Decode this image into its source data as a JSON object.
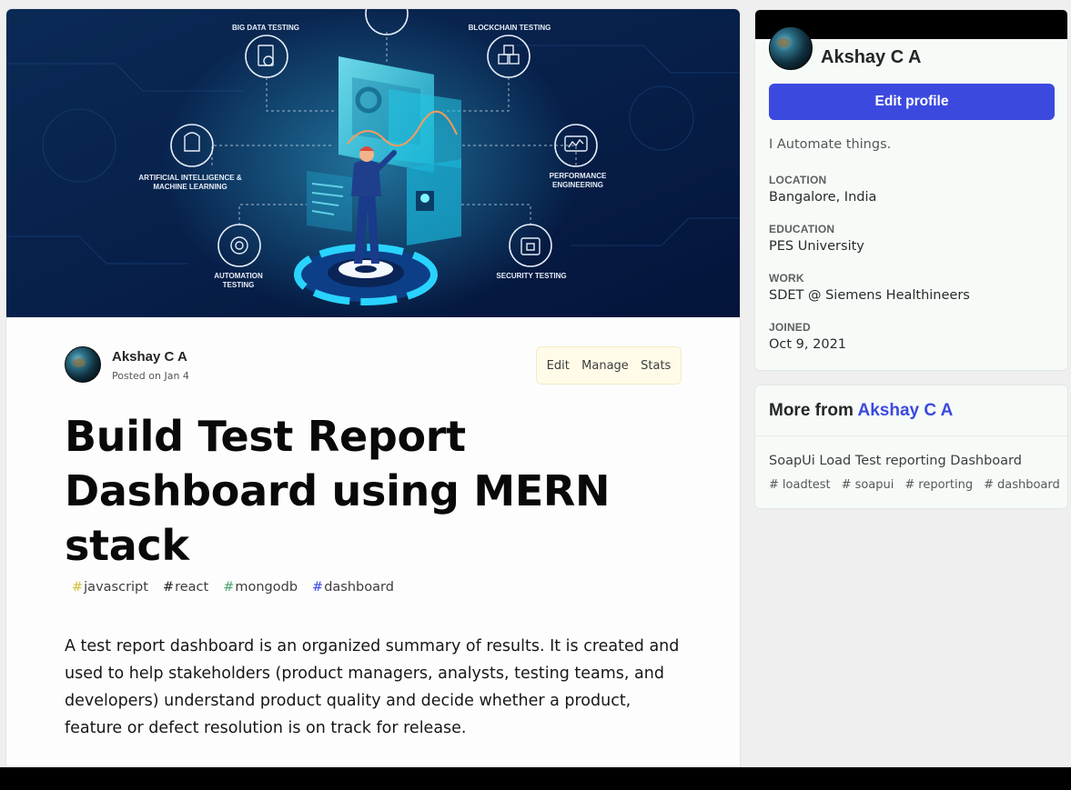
{
  "article": {
    "author": "Akshay C A",
    "posted": "Posted on Jan 4",
    "actions": [
      "Edit",
      "Manage",
      "Stats"
    ],
    "title": "Build Test Report Dashboard using MERN stack",
    "tags": [
      {
        "name": "javascript",
        "color": "#d1c23d"
      },
      {
        "name": "react",
        "color": "#222222"
      },
      {
        "name": "mongodb",
        "color": "#4aa46d"
      },
      {
        "name": "dashboard",
        "color": "#3b49df"
      }
    ],
    "body": "A test report dashboard is an organized summary of results. It is created and used to help stakeholders (product managers, analysts, testing teams, and developers) understand product quality and decide whether a product, feature or defect resolution is on track for release."
  },
  "cover": {
    "labels": {
      "big_data": "BIG DATA TESTING",
      "blockchain": "BLOCKCHAIN TESTING",
      "ai_ml_1": "ARTIFICIAL INTELLIGENCE &",
      "ai_ml_2": "MACHINE LEARNING",
      "perf_1": "PERFORMANCE",
      "perf_2": "ENGINEERING",
      "automation_1": "AUTOMATION",
      "automation_2": "TESTING",
      "security": "SECURITY TESTING"
    }
  },
  "profile": {
    "name": "Akshay C A",
    "edit_label": "Edit profile",
    "bio": "I Automate things.",
    "fields": [
      {
        "label": "LOCATION",
        "value": "Bangalore, India"
      },
      {
        "label": "EDUCATION",
        "value": "PES University"
      },
      {
        "label": "WORK",
        "value": "SDET @ Siemens Healthineers"
      },
      {
        "label": "JOINED",
        "value": "Oct 9, 2021"
      }
    ]
  },
  "more_from": {
    "prefix": "More from",
    "author": "Akshay C A",
    "post_title": "SoapUi Load Test reporting Dashboard",
    "tags": [
      "loadtest",
      "soapui",
      "reporting",
      "dashboard"
    ]
  },
  "colors": {
    "accent": "#3b49df",
    "manage_bg": "#fffbe8"
  }
}
